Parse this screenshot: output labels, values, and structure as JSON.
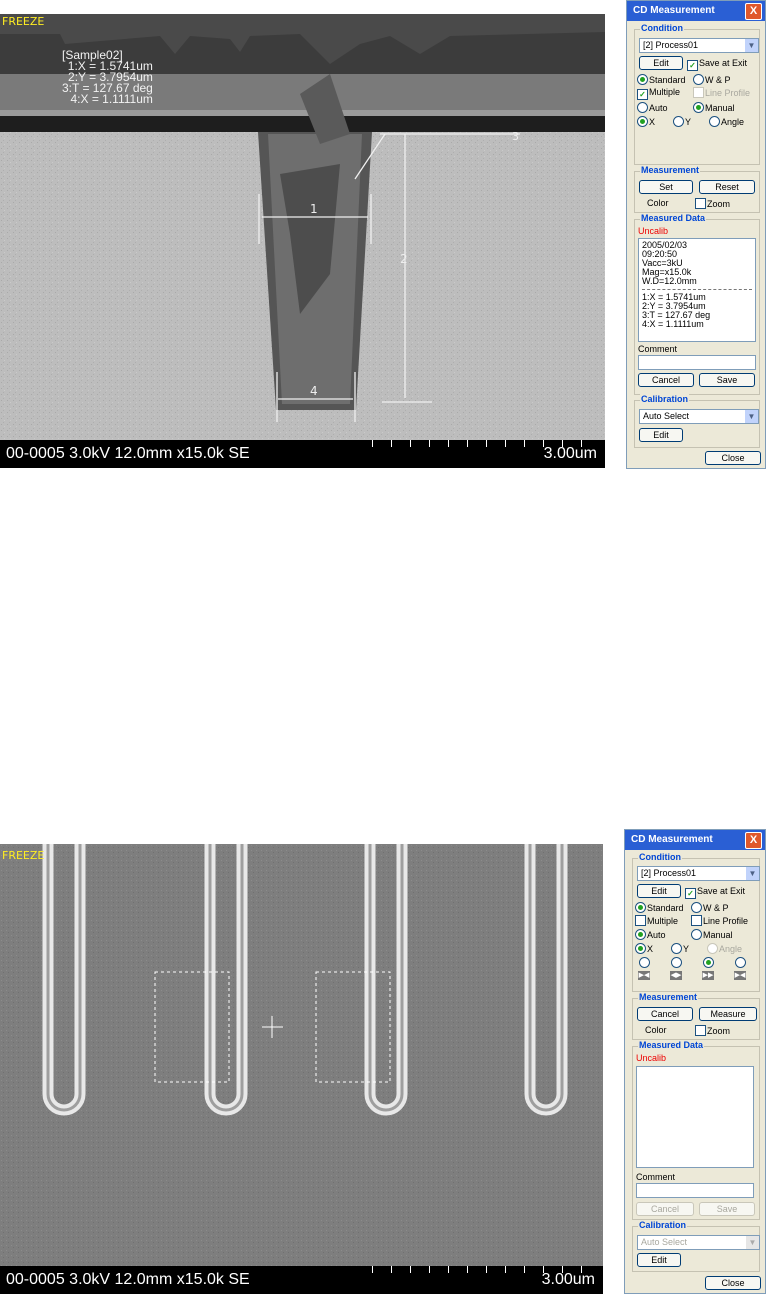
{
  "top": {
    "freeze": "FREEZE",
    "sample": "[Sample02]",
    "measurements": [
      "1:X = 1.5741um",
      "2:Y = 3.7954um",
      "3:T = 127.67 deg",
      "4:X = 1.1111um"
    ],
    "markers": [
      "1",
      "2",
      "3",
      "4"
    ],
    "info_left": "00-0005 3.0kV 12.0mm x15.0k SE",
    "info_right": "3.00um",
    "dialog": {
      "title": "CD Measurement",
      "close_x": "X",
      "condition_title": "Condition",
      "process": "[2] Process01",
      "edit": "Edit",
      "save_at_exit": "Save at Exit",
      "standard": "Standard",
      "wp": "W & P",
      "multiple": "Multiple",
      "line_profile": "Line Profile",
      "auto": "Auto",
      "manual": "Manual",
      "x": "X",
      "y": "Y",
      "angle": "Angle",
      "measurement_title": "Measurement",
      "set": "Set",
      "reset": "Reset",
      "color": "Color",
      "zoom": "Zoom",
      "measured_title": "Measured Data",
      "uncalib": "Uncalib",
      "data_lines": [
        "2005/02/03",
        "09:20:50",
        "Vacc=3kU",
        "Mag=x15.0k",
        "W.D=12.0mm"
      ],
      "data_results": [
        "1:X = 1.5741um",
        "2:Y = 3.7954um",
        "3:T = 127.67 deg",
        "4:X = 1.1111um"
      ],
      "comment": "Comment",
      "cancel": "Cancel",
      "save": "Save",
      "calibration_title": "Calibration",
      "auto_select": "Auto Select",
      "edit2": "Edit",
      "close": "Close"
    }
  },
  "bottom": {
    "freeze": "FREEZE",
    "info_left": "00-0005 3.0kV 12.0mm x15.0k SE",
    "info_right": "3.00um",
    "dialog": {
      "title": "CD Measurement",
      "close_x": "X",
      "condition_title": "Condition",
      "process": "[2] Process01",
      "edit": "Edit",
      "save_at_exit": "Save at Exit",
      "standard": "Standard",
      "wp": "W & P",
      "multiple": "Multiple",
      "line_profile": "Line Profile",
      "auto": "Auto",
      "manual": "Manual",
      "x": "X",
      "y": "Y",
      "angle": "Angle",
      "measurement_title": "Measurement",
      "cancel_m": "Cancel",
      "measure": "Measure",
      "color": "Color",
      "zoom": "Zoom",
      "measured_title": "Measured Data",
      "uncalib": "Uncalib",
      "comment": "Comment",
      "cancel": "Cancel",
      "save": "Save",
      "calibration_title": "Calibration",
      "auto_select": "Auto Select",
      "edit2": "Edit",
      "close": "Close"
    }
  }
}
